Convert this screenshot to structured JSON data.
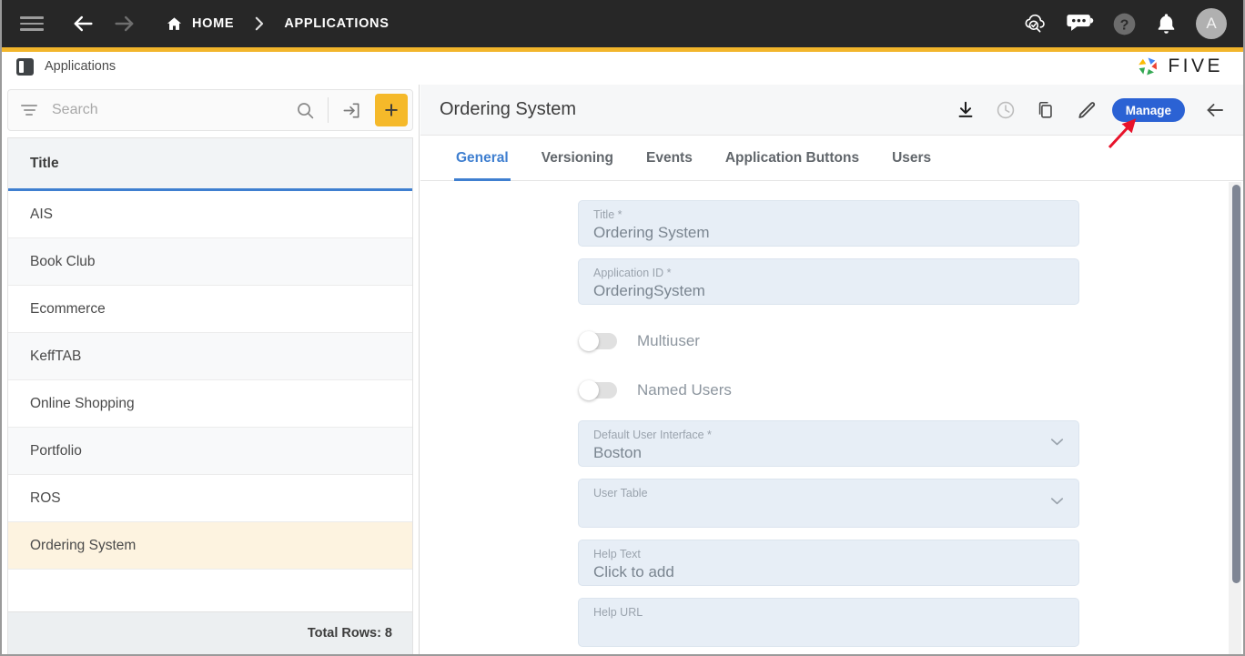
{
  "topbar": {
    "menu_icon": "hamburger-icon",
    "back_icon": "arrow-left-icon",
    "forward_icon": "arrow-right-icon",
    "home_icon": "home-icon",
    "home_label": "HOME",
    "breadcrumb_separator": "›",
    "current_label": "APPLICATIONS",
    "right_icons": [
      {
        "name": "cloud-search-icon"
      },
      {
        "name": "chat-bot-icon"
      },
      {
        "name": "help-icon"
      },
      {
        "name": "notifications-bell-icon"
      }
    ],
    "avatar_initial": "A",
    "background": "#272727",
    "accent_color": "#f2b52b"
  },
  "subheader": {
    "icon": "applications-panel-icon",
    "title": "Applications",
    "brand": "FIVE"
  },
  "left_panel": {
    "search": {
      "filter_icon": "filter-icon",
      "placeholder": "Search",
      "value": "",
      "search_icon": "search-icon",
      "import_icon": "import-icon",
      "add_label": "+"
    },
    "grid": {
      "columns": [
        "Title"
      ],
      "rows": [
        {
          "title": "AIS",
          "selected": false
        },
        {
          "title": "Book Club",
          "selected": false
        },
        {
          "title": "Ecommerce",
          "selected": false
        },
        {
          "title": "KeffTAB",
          "selected": false
        },
        {
          "title": "Online Shopping",
          "selected": false
        },
        {
          "title": "Portfolio",
          "selected": false
        },
        {
          "title": "ROS",
          "selected": false
        },
        {
          "title": "Ordering System",
          "selected": true
        }
      ],
      "footer_text": "Total Rows: 8",
      "selected_color": "#fdf3e0",
      "header_underline": "#3f7fd0"
    }
  },
  "right_panel": {
    "title": "Ordering System",
    "actions": [
      {
        "name": "download-icon",
        "label": "Download"
      },
      {
        "name": "history-clock-icon",
        "label": "History"
      },
      {
        "name": "copy-icon",
        "label": "Copy"
      },
      {
        "name": "edit-pencil-icon",
        "label": "Edit"
      }
    ],
    "manage_label": "Manage",
    "manage_color": "#2b62d4",
    "close_icon": "arrow-left-icon",
    "tabs": [
      {
        "label": "General",
        "active": true
      },
      {
        "label": "Versioning",
        "active": false
      },
      {
        "label": "Events",
        "active": false
      },
      {
        "label": "Application Buttons",
        "active": false
      },
      {
        "label": "Users",
        "active": false
      }
    ],
    "tab_active_color": "#3f7fd0",
    "form": {
      "title": {
        "label": "Title *",
        "value": "Ordering System"
      },
      "application_id": {
        "label": "Application ID *",
        "value": "OrderingSystem"
      },
      "multiuser": {
        "label": "Multiuser",
        "on": false
      },
      "named_users": {
        "label": "Named Users",
        "on": false
      },
      "default_user_interface": {
        "label": "Default User Interface *",
        "value": "Boston"
      },
      "user_table": {
        "label": "User Table",
        "value": ""
      },
      "help_text": {
        "label": "Help Text",
        "value": "Click to add"
      },
      "help_url": {
        "label": "Help URL",
        "value": ""
      }
    }
  },
  "annotation": {
    "arrow_color": "#e8132b",
    "points_to": "manage-button"
  }
}
